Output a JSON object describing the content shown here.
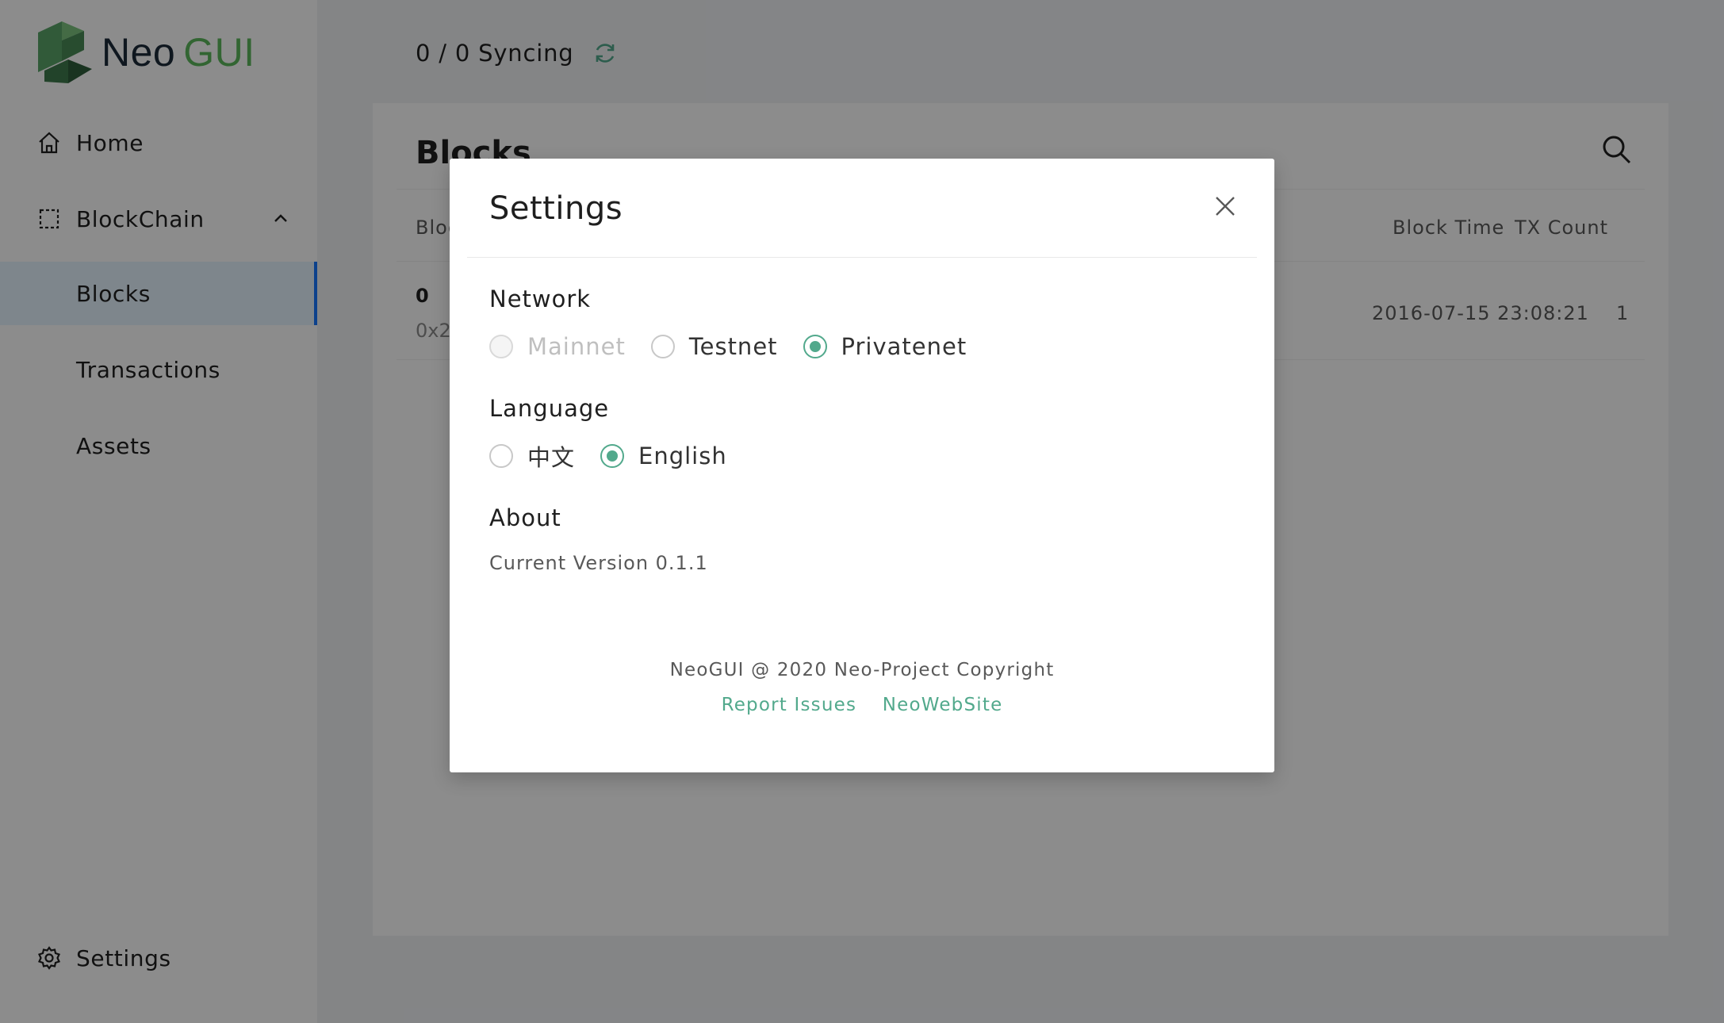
{
  "app": {
    "logo_neo": "Neo",
    "logo_gui": "GUI"
  },
  "sidebar": {
    "items": [
      {
        "label": "Home",
        "icon": "home-icon"
      },
      {
        "label": "BlockChain",
        "icon": "blockchain-icon",
        "expanded": true
      },
      {
        "label": "Blocks",
        "active": true
      },
      {
        "label": "Transactions"
      },
      {
        "label": "Assets"
      }
    ],
    "settings_label": "Settings"
  },
  "topbar": {
    "sync_status": "0 / 0 Syncing"
  },
  "blocks_page": {
    "title": "Blocks",
    "columns": [
      "Bloc",
      "Block Time",
      "TX Count"
    ],
    "rows": [
      {
        "height": "0",
        "hash_prefix": "0x2",
        "time": "2016-07-15 23:08:21",
        "tx_count": "1"
      }
    ]
  },
  "settings_modal": {
    "title": "Settings",
    "network": {
      "label": "Network",
      "options": [
        "Mainnet",
        "Testnet",
        "Privatenet"
      ],
      "selected": "Privatenet",
      "disabled": [
        "Mainnet"
      ]
    },
    "language": {
      "label": "Language",
      "options": [
        "中文",
        "English"
      ],
      "selected": "English"
    },
    "about": {
      "label": "About",
      "version": "Current Version 0.1.1"
    },
    "footer": {
      "copyright": "NeoGUI @ 2020 Neo-Project Copyright",
      "report_issues": "Report Issues",
      "website": "NeoWebSite"
    }
  },
  "colors": {
    "accent": "#52a98c",
    "logo_green": "#5cb85c",
    "logo_dark": "#1c2b3a"
  }
}
